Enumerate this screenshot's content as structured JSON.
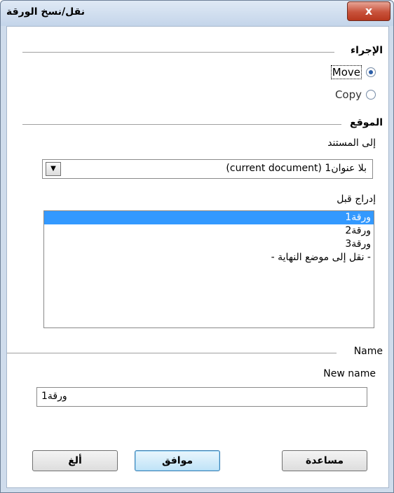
{
  "window": {
    "title": "نقل/نسخ الورقة",
    "close_label": "x"
  },
  "action": {
    "section_label": "الإجراء",
    "move_label": "Move",
    "copy_label": "Copy",
    "selected": "Move"
  },
  "location": {
    "section_label": "الموقع",
    "to_document_label": "إلى المستند",
    "document_value": "بلا عنوان1 (current document)",
    "insert_before_label": "إدراج قبل",
    "sheets": [
      "ورقة1",
      "ورقة2",
      "ورقة3",
      "- نقل إلى موضع النهاية -"
    ],
    "selected_index": 0
  },
  "name": {
    "section_label": "Name",
    "new_name_label": "New name",
    "new_name_value": "ورقة1"
  },
  "buttons": {
    "help": "مساعدة",
    "ok": "موافق",
    "cancel": "ألغ"
  }
}
